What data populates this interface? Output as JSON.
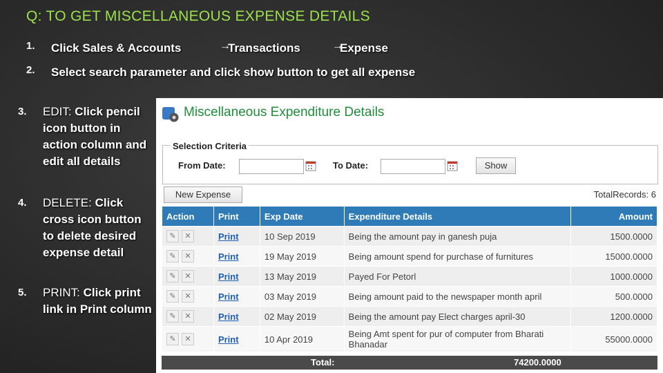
{
  "slide": {
    "title": "Q: TO GET MISCELLANEOUS EXPENSE DETAILS",
    "steps": [
      {
        "num": "1.",
        "parts": [
          "Click  Sales & Accounts",
          "Transactions",
          "Expense"
        ]
      },
      {
        "num": "2.",
        "text": "Select search parameter and click show button to get all expense"
      },
      {
        "num": "3.",
        "label": "EDIT:",
        "text": "Click pencil icon button in action column and edit all details"
      },
      {
        "num": "4.",
        "label": "DELETE:",
        "text": "Click cross icon button to delete desired expense detail"
      },
      {
        "num": "5.",
        "label": "PRINT:",
        "text": "Click print link in Print column"
      }
    ],
    "arrow_glyph": "→"
  },
  "panel": {
    "title": "Miscellaneous Expenditure Details",
    "criteria_legend": "Selection Criteria",
    "from_label": "From Date:",
    "to_label": "To Date:",
    "from_value": "",
    "to_value": "",
    "show_label": "Show",
    "new_label": "New Expense",
    "total_records_label": "TotalRecords: 6"
  },
  "table": {
    "headers": [
      "Action",
      "Print",
      "Exp Date",
      "Expenditure Details",
      "Amount"
    ],
    "rows": [
      {
        "print": "Print",
        "date": "10 Sep 2019",
        "details": "Being the amount pay in ganesh puja",
        "amount": "1500.0000"
      },
      {
        "print": "Print",
        "date": "19 May 2019",
        "details": "Being amount spend for purchase of furnitures",
        "amount": "15000.0000"
      },
      {
        "print": "Print",
        "date": "13 May 2019",
        "details": "Payed For Petorl",
        "amount": "1000.0000"
      },
      {
        "print": "Print",
        "date": "03 May 2019",
        "details": "Being amount paid to the newspaper month april",
        "amount": "500.0000"
      },
      {
        "print": "Print",
        "date": "02 May 2019",
        "details": "Being the amount pay Elect charges april-30",
        "amount": "1200.0000"
      },
      {
        "print": "Print",
        "date": "10 Apr 2019",
        "details": "Being Amt spent for pur of computer from Bharati Bhanadar",
        "amount": "55000.0000"
      }
    ],
    "total_label": "Total:",
    "total_value": "74200.0000"
  },
  "icons": [
    "gear-icon",
    "calendar-icon",
    "pencil-icon",
    "cross-icon"
  ],
  "colors": {
    "title_green": "#9be24a",
    "panel_title_green": "#1f8f3a",
    "header_blue": "#2e7bb8",
    "link_blue": "#1f5fb0"
  }
}
